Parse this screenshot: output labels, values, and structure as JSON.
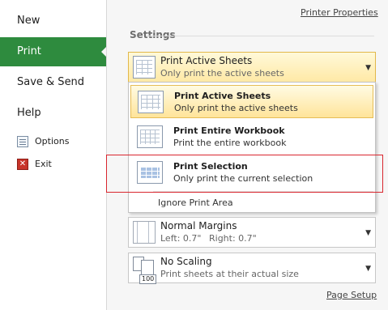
{
  "nav": {
    "new": "New",
    "print": "Print",
    "save_send": "Save & Send",
    "help": "Help",
    "options": "Options",
    "exit": "Exit"
  },
  "links": {
    "printer_properties": "Printer Properties",
    "page_setup": "Page Setup"
  },
  "settings_title": "Settings",
  "print_what": {
    "title": "Print Active Sheets",
    "subtitle": "Only print the active sheets"
  },
  "menu": {
    "items": [
      {
        "title": "Print Active Sheets",
        "subtitle": "Only print the active sheets",
        "icon": "active-sheets-icon"
      },
      {
        "title": "Print Entire Workbook",
        "subtitle": "Print the entire workbook",
        "icon": "workbook-icon"
      },
      {
        "title": "Print Selection",
        "subtitle": "Only print the current selection",
        "icon": "selection-icon"
      }
    ],
    "ignore_print_area": "Ignore Print Area"
  },
  "margins": {
    "title": "Normal Margins",
    "left": "Left:  0.7\"",
    "right": "Right:  0.7\""
  },
  "scaling": {
    "title": "No Scaling",
    "subtitle": "Print sheets at their actual size",
    "icon_label": "100"
  },
  "colors": {
    "active_nav": "#2e8b3e",
    "highlight": "#ffe49a",
    "callout": "#d9262e"
  }
}
